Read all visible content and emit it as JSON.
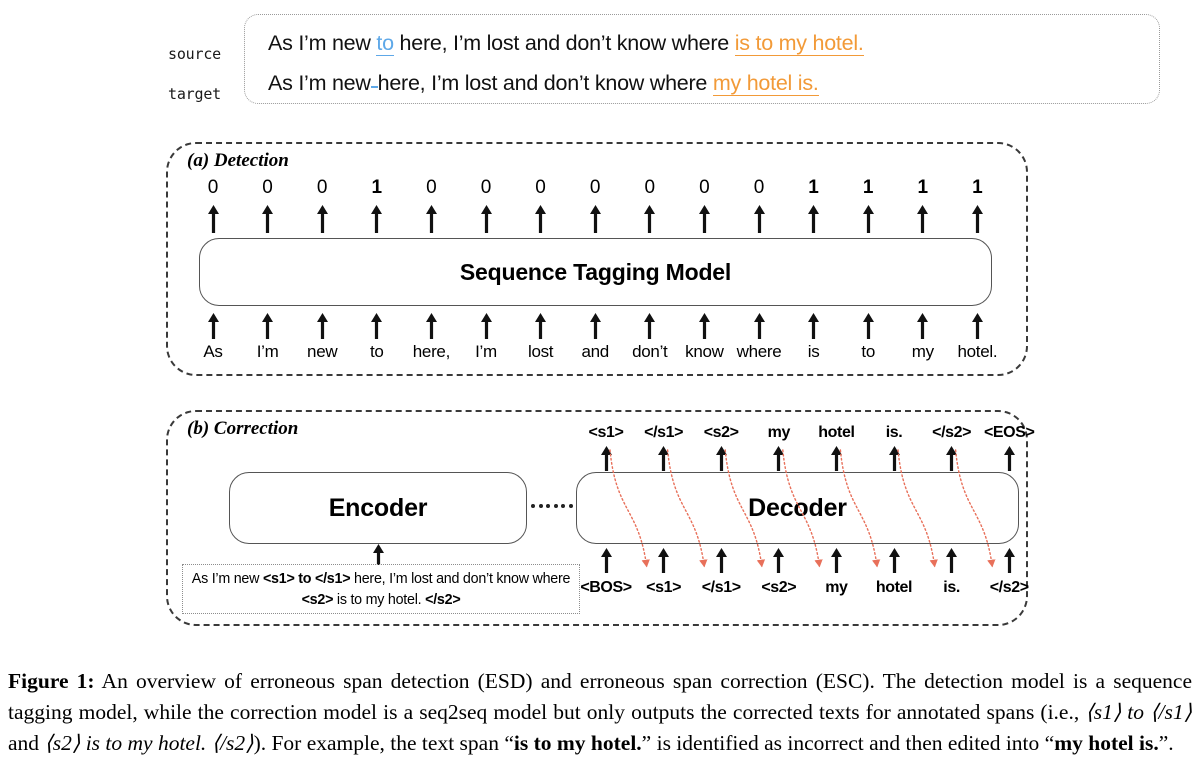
{
  "figure": {
    "caption_label": "Figure 1:",
    "caption_text": " An overview of erroneous span detection (ESD) and erroneous span correction (ESC). The detection model is a sequence tagging model, while the correction model is a seq2seq model but only outputs the corrected texts for annotated spans (i.e., ",
    "caption_span1": "⟨s1⟩ to ⟨/s1⟩",
    "caption_mid1": " and ",
    "caption_span2": "⟨s2⟩ is to my hotel. ⟨/s2⟩",
    "caption_mid2": "). For example, the text span “",
    "caption_bold1": "is to my hotel.",
    "caption_mid3": "” is identified as incorrect and then edited into “",
    "caption_bold2": "my hotel is.",
    "caption_end": "”."
  },
  "io": {
    "source_label": "source",
    "target_label": "target",
    "source": {
      "pre": "As I’m new ",
      "blue": "to",
      "mid": " here, I’m lost and don’t know where ",
      "orange": "is to my hotel."
    },
    "target": {
      "pre": "As I’m new",
      "mid": "here, I’m lost and don’t know where ",
      "orange": "my hotel is."
    },
    "colors": {
      "blue": "#5EA8E8",
      "orange": "#F29A38"
    }
  },
  "detection": {
    "title": "(a) Detection",
    "model_label": "Sequence Tagging Model",
    "tokens": [
      "As",
      "I’m",
      "new",
      "to",
      "here,",
      "I’m",
      "lost",
      "and",
      "don’t",
      "know",
      "where",
      "is",
      "to",
      "my",
      "hotel."
    ],
    "tags": [
      "0",
      "0",
      "0",
      "1",
      "0",
      "0",
      "0",
      "0",
      "0",
      "0",
      "0",
      "1",
      "1",
      "1",
      "1"
    ]
  },
  "correction": {
    "title": "(b) Correction",
    "encoder_label": "Encoder",
    "decoder_label": "Decoder",
    "encoder_input": {
      "p1": "As I’m new ",
      "b1": "<s1> to </s1>",
      "p2": " here, I’m lost and don’t know where ",
      "b2": "<s2>",
      "p3": " is to my hotel. ",
      "b3": "</s2>"
    },
    "decoder_outputs": [
      "<s1>",
      "</s1>",
      "<s2>",
      "my",
      "hotel",
      "is.",
      "</s2>",
      "<EOS>"
    ],
    "decoder_inputs": [
      "<BOS>",
      "<s1>",
      "</s1>",
      "<s2>",
      "my",
      "hotel",
      "is.",
      "</s2>"
    ],
    "feedback_color": "#E8705A"
  }
}
